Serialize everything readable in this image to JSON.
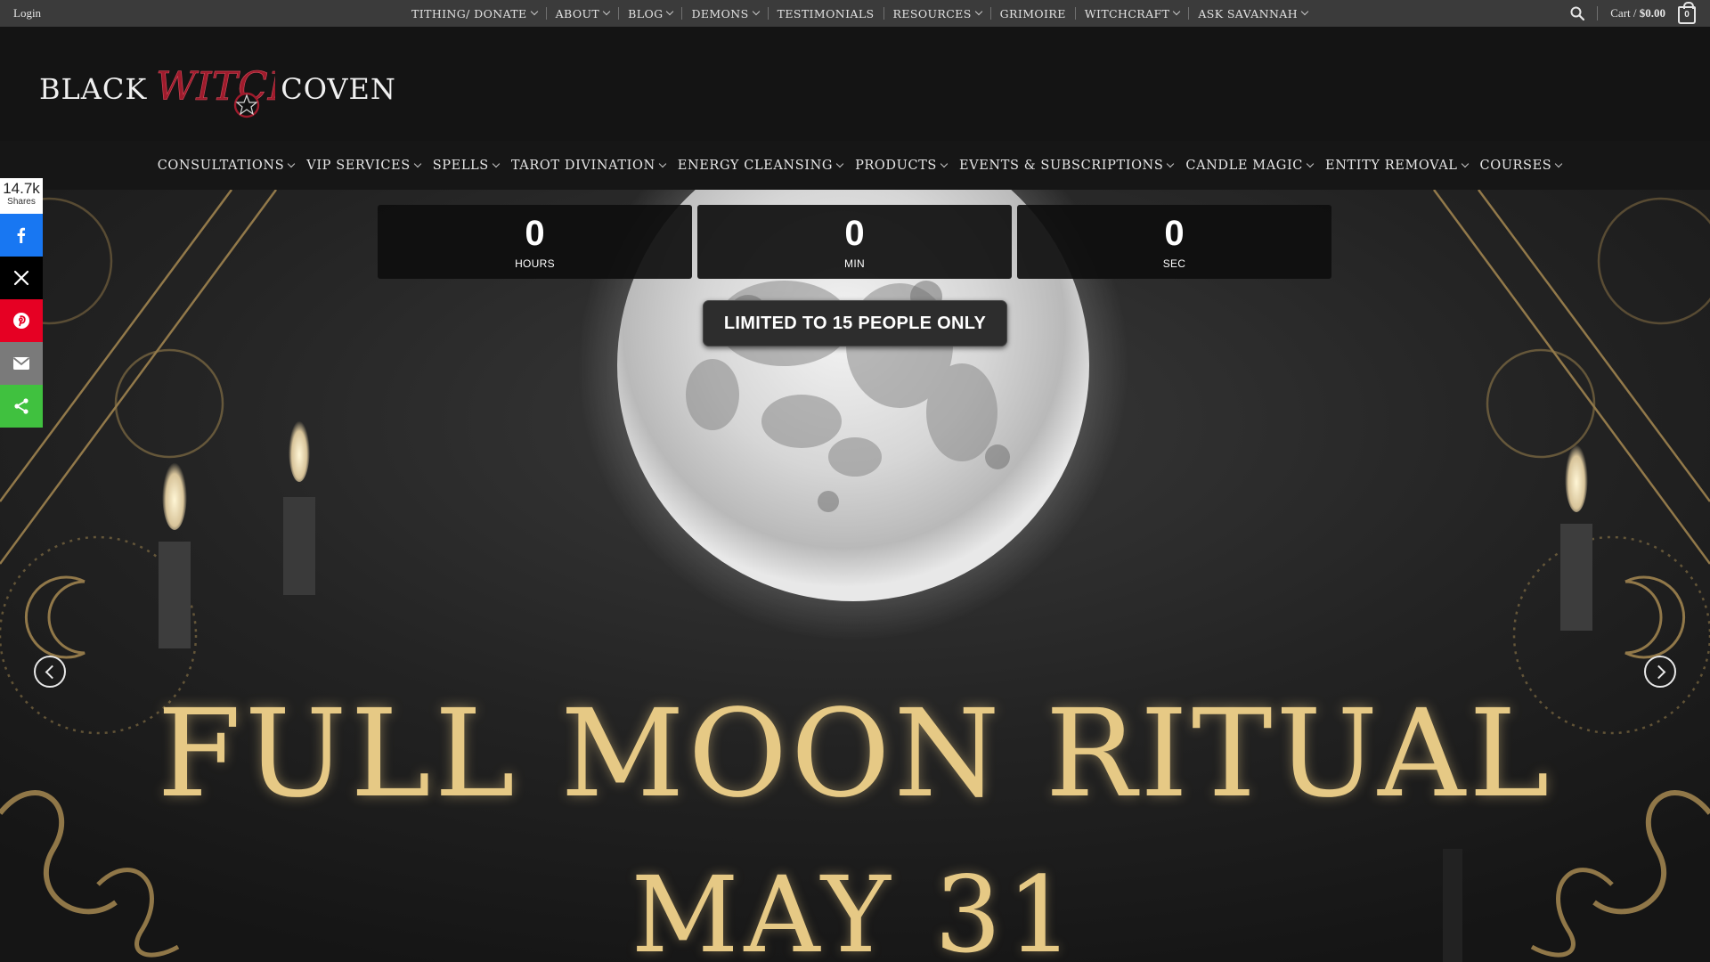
{
  "topbar": {
    "login": "Login",
    "nav": [
      {
        "label": "TITHING/ DONATE",
        "dropdown": true
      },
      {
        "label": "ABOUT",
        "dropdown": true
      },
      {
        "label": "BLOG",
        "dropdown": true
      },
      {
        "label": "DEMONS",
        "dropdown": true
      },
      {
        "label": "TESTIMONIALS",
        "dropdown": false
      },
      {
        "label": "RESOURCES",
        "dropdown": true
      },
      {
        "label": "GRIMOIRE",
        "dropdown": false
      },
      {
        "label": "WITCHCRAFT",
        "dropdown": true
      },
      {
        "label": "ASK SAVANNAH",
        "dropdown": true
      }
    ],
    "cart_label": "Cart / ",
    "cart_total": "$0.00",
    "cart_count": "0"
  },
  "logo": {
    "left_word": "BLACK",
    "script_word": "WITCH",
    "right_word": "COVEN",
    "accent_color": "#9e1b2c"
  },
  "mainnav": [
    {
      "label": "CONSULTATIONS"
    },
    {
      "label": "VIP SERVICES"
    },
    {
      "label": "SPELLS"
    },
    {
      "label": "TAROT DIVINATION"
    },
    {
      "label": "ENERGY CLEANSING"
    },
    {
      "label": "PRODUCTS"
    },
    {
      "label": "EVENTS & SUBSCRIPTIONS"
    },
    {
      "label": "CANDLE MAGIC"
    },
    {
      "label": "ENTITY REMOVAL"
    },
    {
      "label": "COURSES"
    }
  ],
  "hero": {
    "countdown": [
      {
        "value": "0",
        "label": "HOURS"
      },
      {
        "value": "0",
        "label": "MIN"
      },
      {
        "value": "0",
        "label": "SEC"
      }
    ],
    "limited_label": "LIMITED TO 15 PEOPLE ONLY",
    "title": "FULL MOON RITUAL",
    "date": "MAY 31",
    "gold_color": "#e6c985"
  },
  "share": {
    "count": "14.7k",
    "label": "Shares",
    "buttons": [
      "facebook-icon",
      "x-icon",
      "pinterest-icon",
      "email-icon",
      "share-icon"
    ]
  }
}
